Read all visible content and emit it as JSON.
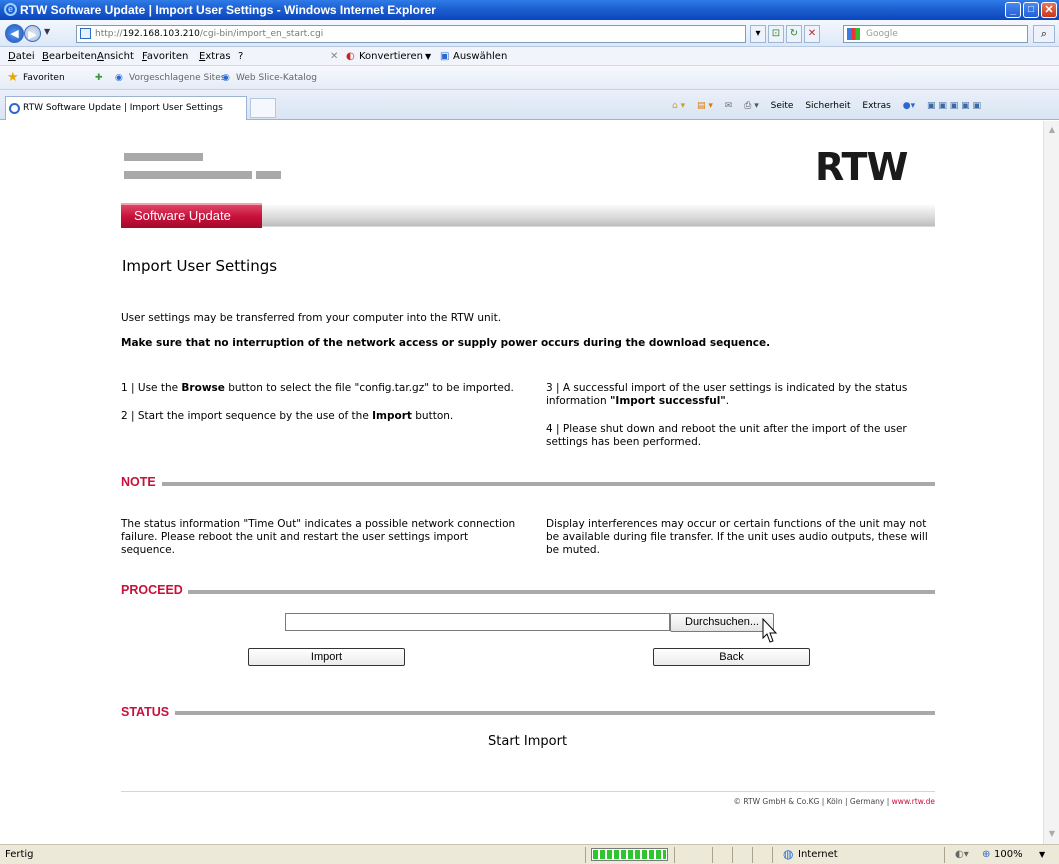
{
  "window": {
    "title": "RTW Software Update | Import User Settings - Windows Internet Explorer",
    "minimize": "_",
    "maximize": "□",
    "close": "✕"
  },
  "address": {
    "url_prefix": "http://",
    "url_host": "192.168.103.210",
    "url_path": "/cgi-bin/import_en_start.cgi",
    "search_placeholder": "Google"
  },
  "menu": {
    "items": [
      "Datei",
      "Bearbeiten",
      "Ansicht",
      "Favoriten",
      "Extras",
      "?"
    ],
    "convert": "Konvertieren",
    "select": "Auswählen"
  },
  "favorites": {
    "label": "Favoriten",
    "suggested": "Vorgeschlagene Sites",
    "webslice": "Web Slice-Katalog"
  },
  "tab": {
    "title": "RTW Software Update | Import User Settings"
  },
  "commands": {
    "page": "Seite",
    "security": "Sicherheit",
    "extras": "Extras"
  },
  "content": {
    "logo": "RTW",
    "nav_tab": "Software Update",
    "heading": "Import User Settings",
    "intro": "User settings may be transferred from your computer into the RTW unit.",
    "warning": "Make sure that no interruption of the network access or supply power occurs during the download sequence.",
    "step1_pre": "1 | Use the ",
    "step1_bold": "Browse",
    "step1_post": " button to select the file \"config.tar.gz\" to be imported.",
    "step2_pre": "2 | Start the import sequence by the use of the ",
    "step2_bold": "Import",
    "step2_post": " button.",
    "step3_pre": "3 | A successful import of the user settings is indicated by the status information ",
    "step3_bold": "\"Import successful\"",
    "step3_post": ".",
    "step4": "4 | Please shut down and reboot the unit after the import of the user settings has been performed.",
    "note_title": "NOTE",
    "note_left": "The status information \"Time Out\" indicates a possible network connection failure. Please reboot the unit and restart the user settings import sequence.",
    "note_right": "Display interferences may occur or certain functions of the unit may not be available during file transfer. If the unit uses audio outputs, these will be muted.",
    "proceed_title": "PROCEED",
    "file_value": "",
    "browse_label": "Durchsuchen...",
    "import_label": "Import",
    "back_label": "Back",
    "status_title": "STATUS",
    "status_text": "Start Import",
    "footer_text": "© RTW GmbH & Co.KG | Köln | Germany | ",
    "footer_link": "www.rtw.de"
  },
  "statusbar": {
    "left": "Fertig",
    "zone": "Internet",
    "zoom": "100%",
    "progress": 1.0
  }
}
